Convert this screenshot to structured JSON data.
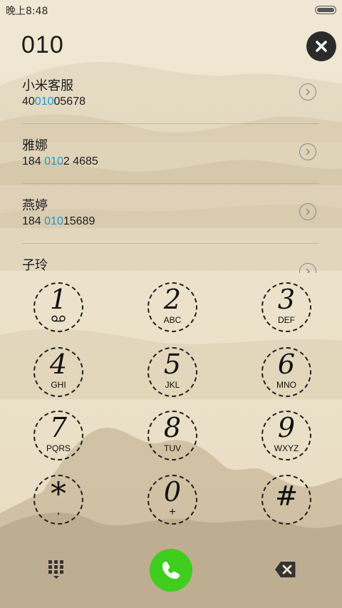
{
  "status_bar": {
    "time": "晚上8:48"
  },
  "dialer": {
    "input_number": "010"
  },
  "matches": [
    {
      "name": "小米客服",
      "number_parts": [
        "40",
        "010",
        "05678"
      ]
    },
    {
      "name": "雅娜",
      "number_parts": [
        "184 ",
        "010",
        "2 4685"
      ]
    },
    {
      "name": "燕婷",
      "number_parts": [
        "184 ",
        "010",
        "15689"
      ]
    },
    {
      "name": "子玲",
      "number_parts": [
        "",
        "",
        ""
      ]
    }
  ],
  "keypad": [
    {
      "digit": "1",
      "letters": ""
    },
    {
      "digit": "2",
      "letters": "ABC"
    },
    {
      "digit": "3",
      "letters": "DEF"
    },
    {
      "digit": "4",
      "letters": "GHI"
    },
    {
      "digit": "5",
      "letters": "JKL"
    },
    {
      "digit": "6",
      "letters": "MNO"
    },
    {
      "digit": "7",
      "letters": "PQRS"
    },
    {
      "digit": "8",
      "letters": "TUV"
    },
    {
      "digit": "9",
      "letters": "WXYZ"
    },
    {
      "digit": "*",
      "letters": ","
    },
    {
      "digit": "0",
      "letters": "+"
    },
    {
      "digit": "#",
      "letters": ""
    }
  ],
  "colors": {
    "highlight": "#1c9ad6",
    "call_button": "#3fcd1e",
    "background": "#ece2cd"
  },
  "icons": {
    "clear": "close-icon",
    "keypad_toggle": "dialpad-icon",
    "call": "phone-icon",
    "delete": "backspace-icon",
    "voicemail": "voicemail-icon",
    "chevron": "chevron-right-icon"
  }
}
